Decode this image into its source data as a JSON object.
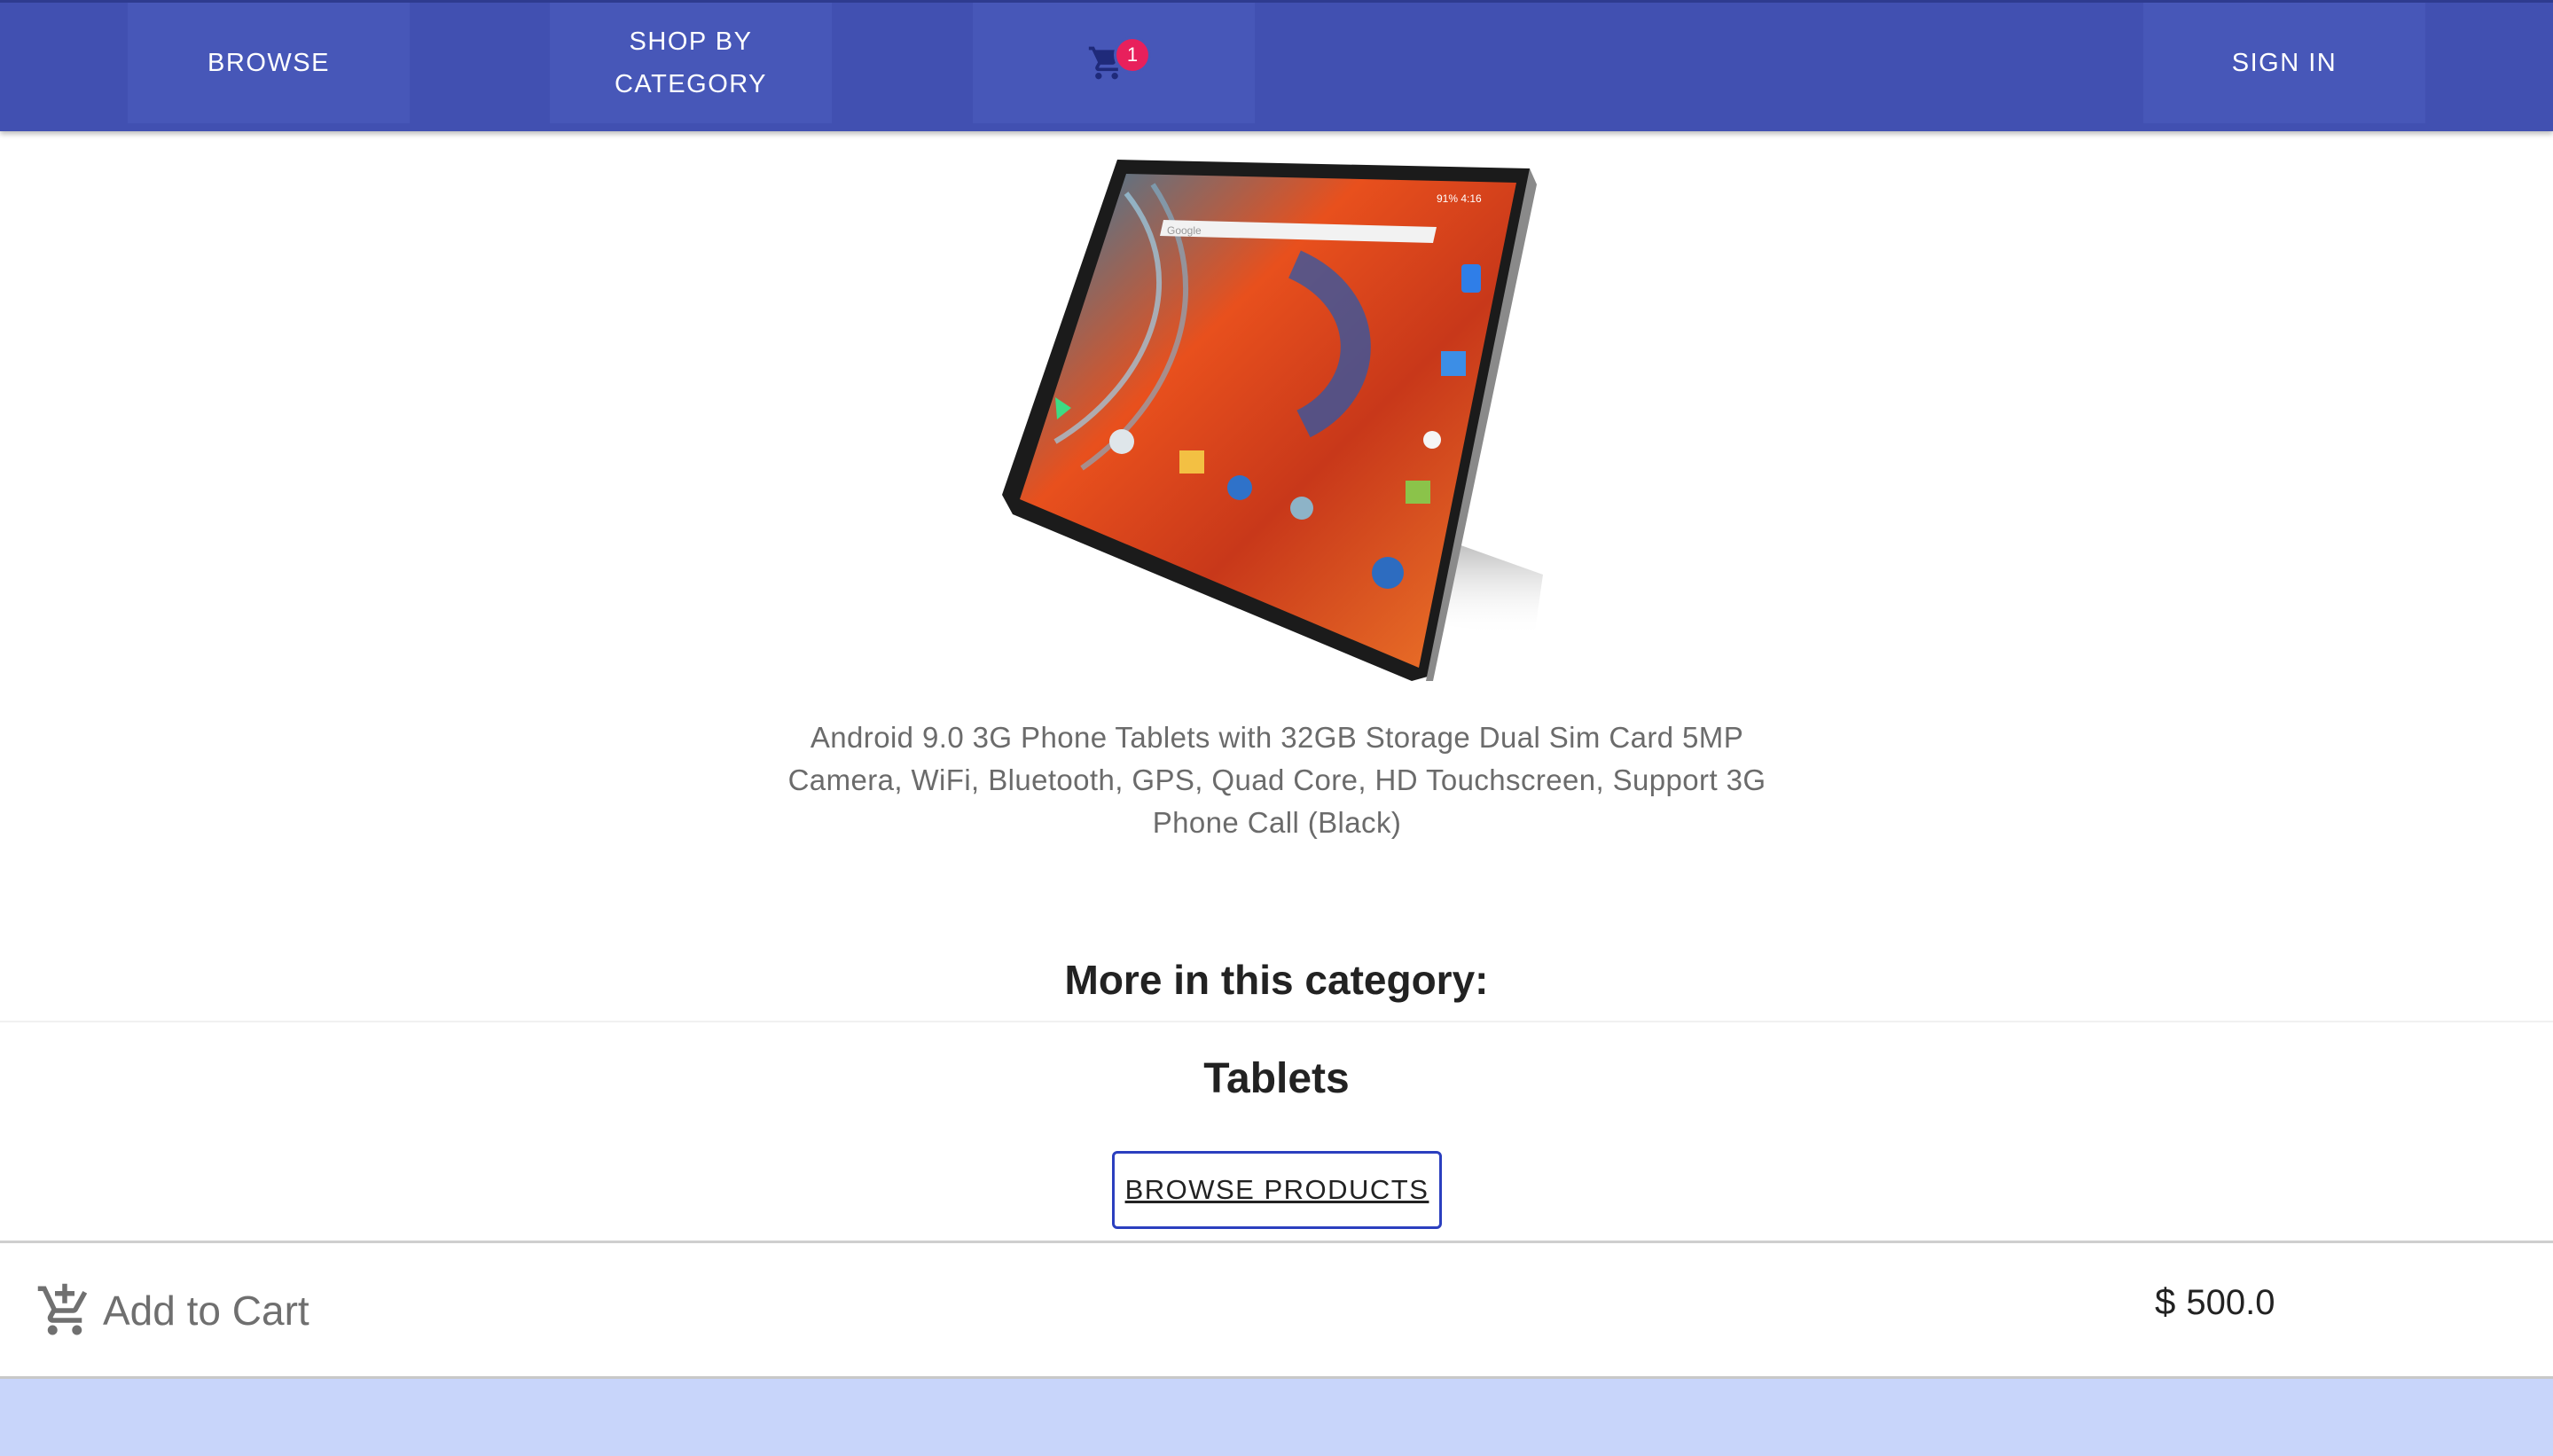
{
  "nav": {
    "browse_label": "BROWSE",
    "shop_by_category_label": "SHOP BY\nCATEGORY",
    "cart_count": "1",
    "sign_in_label": "SIGN IN"
  },
  "product": {
    "image_alt": "Android tablet",
    "description": "Android 9.0 3G Phone Tablets with 32GB Storage Dual Sim Card 5MP Camera, WiFi, Bluetooth, GPS, Quad Core, HD Touchscreen, Support 3G Phone Call (Black)",
    "screen_search_text": "Google",
    "screen_status_text": "91%  4:16"
  },
  "related": {
    "heading": "More in this category:",
    "category_name": "Tablets",
    "browse_button_label": "BROWSE PRODUCTS"
  },
  "purchase": {
    "add_to_cart_label": "Add to Cart",
    "currency_symbol": "$",
    "price": "500.0"
  },
  "colors": {
    "appbar": "#4150b1",
    "nav_button": "#4757b8",
    "badge": "#e8205c",
    "footer_band": "#c8d5fa",
    "button_border": "#2b3fbf"
  },
  "icons": {
    "cart": "shopping-cart-icon",
    "add_to_cart": "add-shopping-cart-icon"
  }
}
